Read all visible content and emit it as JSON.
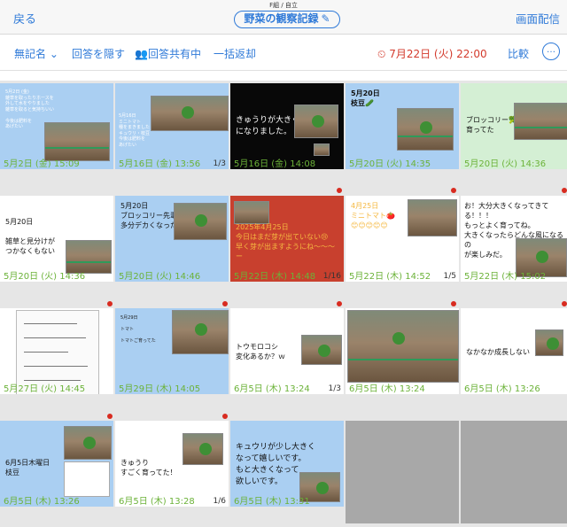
{
  "header": {
    "back_label": "戻る",
    "class_label": "F組 / 自立",
    "title": "野菜の観察記録",
    "deliver_label": "画面配信"
  },
  "toolbar": {
    "unnamed_label": "無記名",
    "hide_answers_label": "回答を隠す",
    "sharing_label": "回答共有中",
    "bulk_return_label": "一括返却",
    "deadline": "7月22日 (火) 22:00",
    "compare_label": "比較",
    "more_label": "…"
  },
  "colors": {
    "accent": "#2f7ad8",
    "timestamp": "#6bb238",
    "alert": "#d33a2c"
  },
  "cards": [
    {
      "text": "",
      "timestamp": "5月2日 (金) 15:09",
      "count": "",
      "new": false
    },
    {
      "text": "",
      "timestamp": "5月16日 (金) 13:56",
      "count": "1/3",
      "new": false
    },
    {
      "text": "きゅうりが大きく\nになりました。",
      "timestamp": "5月16日 (金) 14:08",
      "count": "",
      "new": false
    },
    {
      "text": "5月20日\n枝豆🥒",
      "timestamp": "5月20日 (火) 14:35",
      "count": "",
      "new": false
    },
    {
      "text": "ブロッコリー🥦\n育ってた",
      "timestamp": "5月20日 (火) 14:36",
      "count": "",
      "new": false
    },
    {
      "text": "5月20日\n\n雑草と見分けが\nつかなくもない",
      "timestamp": "5月20日 (火) 14:36",
      "count": "",
      "new": false
    },
    {
      "text": "5月20日\nブロッコリー先輩\n多分デカくなった",
      "timestamp": "5月20日 (火) 14:46",
      "count": "",
      "new": false
    },
    {
      "text": "2025年4月25日\n今日はまだ芽が出ていない😢\n早く芽が出ますようにね〜〜〜\nー",
      "timestamp": "5月22日 (木) 14:48",
      "count": "1/16",
      "new": true
    },
    {
      "text": "4月25日\nミニトマト🍅\n😊😊😊😊😊",
      "timestamp": "5月22日 (木) 14:52",
      "count": "1/5",
      "new": true
    },
    {
      "text": "お！大分大きくなってきて\nる！！！\nもっとよく育ってね。\n大きくなったらどんな風になるの\nが楽しみだ。",
      "timestamp": "5月22日 (木) 15:02",
      "count": "",
      "new": true
    },
    {
      "text": "",
      "timestamp": "5月27日 (火) 14:45",
      "count": "",
      "new": true
    },
    {
      "text": "5月29日\n\nトマト\n\nトマトご育ってた",
      "timestamp": "5月29日 (木) 14:05",
      "count": "",
      "new": true
    },
    {
      "text": "トウモロコシ\n変化あるか？ｗ",
      "timestamp": "6月5日 (木) 13:24",
      "count": "1/3",
      "new": true
    },
    {
      "text": "",
      "timestamp": "6月5日 (木) 13:24",
      "count": "",
      "new": true
    },
    {
      "text": "なかなか成長しない",
      "timestamp": "6月5日 (木) 13:26",
      "count": "",
      "new": true
    },
    {
      "text": "6月5日木曜日\n枝豆",
      "timestamp": "6月5日 (木) 13:26",
      "count": "",
      "new": true
    },
    {
      "text": "きゅうり\nすごく育ってた！",
      "timestamp": "6月5日 (木) 13:28",
      "count": "1/6",
      "new": true
    },
    {
      "text": "キュウリが少し大きく\nなって嬉しいです。\nもと大きくなって\n欲しいです。",
      "timestamp": "6月5日 (木) 13:31",
      "count": "",
      "new": false
    }
  ]
}
